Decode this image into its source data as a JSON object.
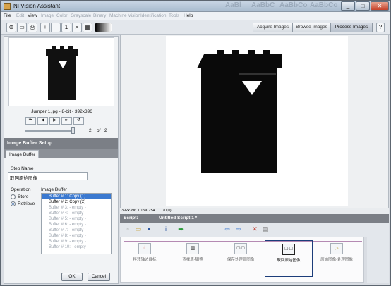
{
  "window": {
    "title": "NI Vision Assistant",
    "ghost_text": [
      "AaBl",
      "AaBbC",
      "AaBbCo",
      "AaBbCo"
    ]
  },
  "menu": [
    "File",
    "Edit",
    "View",
    "Image",
    "Color",
    "Grayscale",
    "Binary",
    "Machine Vision",
    "Identification",
    "Tools",
    "Help"
  ],
  "modes": {
    "acquire": "Acquire Images",
    "browse": "Browse Images",
    "process": "Process Images",
    "active": "process"
  },
  "thumbnail": {
    "caption": "Jumper 1.jpg - 8-bit - 392x396",
    "page_current": "2",
    "page_of": "of",
    "page_total": "2"
  },
  "setup": {
    "header": "Image Buffer Setup",
    "tab": "Image Buffer",
    "step_name_label": "Step Name",
    "step_name_value": "取回原始图像",
    "operation_label": "Operation",
    "store_label": "Store",
    "retrieve_label": "Retrieve",
    "selected_operation": "Retrieve",
    "image_buffer_label": "Image Buffer",
    "buffers": [
      {
        "label": "Buffer # 1:",
        "value": "Copy (1)"
      },
      {
        "label": "Buffer # 2:",
        "value": "Copy (2)"
      },
      {
        "label": "Buffer # 3:",
        "value": "- empty -"
      },
      {
        "label": "Buffer # 4:",
        "value": "- empty -"
      },
      {
        "label": "Buffer # 5:",
        "value": "- empty -"
      },
      {
        "label": "Buffer # 6:",
        "value": "- empty -"
      },
      {
        "label": "Buffer # 7:",
        "value": "- empty -"
      },
      {
        "label": "Buffer # 8:",
        "value": "- empty -"
      },
      {
        "label": "Buffer # 9:",
        "value": "- empty -"
      },
      {
        "label": "Buffer # 10:",
        "value": "- empty -"
      }
    ],
    "ok_label": "OK",
    "cancel_label": "Cancel"
  },
  "status": {
    "size_zoom": "392x396 1.15X 254",
    "coords": "(0,0)"
  },
  "script": {
    "header_label": "Script:",
    "name": "Untitled Script 1 *",
    "steps": [
      {
        "label": "移转轴边目标",
        "icon": "d:"
      },
      {
        "label": "查找表-钼等",
        "icon": "▥"
      },
      {
        "label": "保存处理后图像",
        "icon": "□·□"
      },
      {
        "label": "取回原始图像",
        "icon": "□·□"
      },
      {
        "label": "原始图像-处理图像",
        "icon": "▷"
      }
    ],
    "selected_step": 3
  },
  "colors": {
    "accent": "#3b79d0",
    "header_bg": "#7b7f86",
    "selected_step_border": "#1c3d7a"
  }
}
